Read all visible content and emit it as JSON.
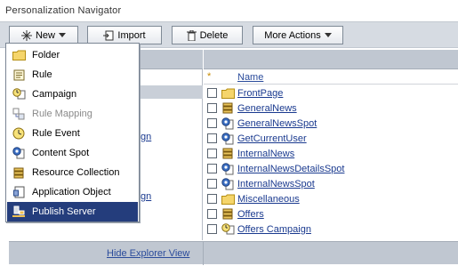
{
  "window": {
    "title": "Personalization Navigator"
  },
  "toolbar": {
    "new_label": "New",
    "import_label": "Import",
    "delete_label": "Delete",
    "more_actions_label": "More Actions"
  },
  "left_panel": {
    "partial_items": [
      "gn",
      "gn"
    ]
  },
  "table": {
    "sort_marker": "*",
    "column_name": "Name",
    "rows": [
      {
        "name": "FrontPage",
        "icon": "folder-icon"
      },
      {
        "name": "GeneralNews",
        "icon": "resource-collection-icon"
      },
      {
        "name": "GeneralNewsSpot",
        "icon": "content-spot-icon"
      },
      {
        "name": "GetCurrentUser",
        "icon": "content-spot-icon"
      },
      {
        "name": "InternalNews",
        "icon": "resource-collection-icon"
      },
      {
        "name": "InternalNewsDetailsSpot",
        "icon": "content-spot-icon"
      },
      {
        "name": "InternalNewsSpot",
        "icon": "content-spot-icon"
      },
      {
        "name": "Miscellaneous",
        "icon": "folder-icon"
      },
      {
        "name": "Offers",
        "icon": "resource-collection-icon"
      },
      {
        "name": "Offers Campaign",
        "icon": "campaign-icon"
      }
    ]
  },
  "footer": {
    "hide_explorer": "Hide Explorer View"
  },
  "new_menu": {
    "items": [
      {
        "label": "Folder",
        "icon": "folder-icon",
        "enabled": true
      },
      {
        "label": "Rule",
        "icon": "rule-icon",
        "enabled": true
      },
      {
        "label": "Campaign",
        "icon": "campaign-icon",
        "enabled": true
      },
      {
        "label": "Rule Mapping",
        "icon": "rule-mapping-icon",
        "enabled": false
      },
      {
        "label": "Rule Event",
        "icon": "rule-event-icon",
        "enabled": true
      },
      {
        "label": "Content Spot",
        "icon": "content-spot-icon",
        "enabled": true
      },
      {
        "label": "Resource Collection",
        "icon": "resource-collection-icon",
        "enabled": true
      },
      {
        "label": "Application Object",
        "icon": "application-object-icon",
        "enabled": true
      },
      {
        "label": "Publish Server",
        "icon": "publish-server-icon",
        "enabled": true,
        "highlighted": true
      }
    ]
  },
  "colors": {
    "link": "#1a3a8f",
    "highlight": "#243d7c",
    "panel_header": "#c0c7d1"
  }
}
